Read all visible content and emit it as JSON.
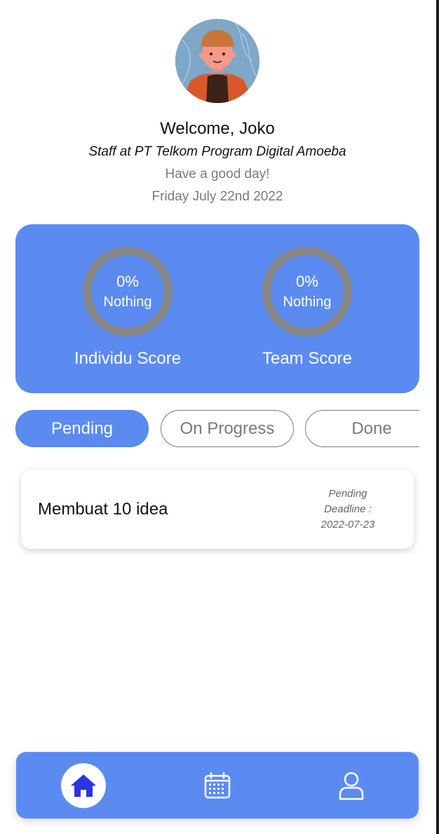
{
  "profile": {
    "welcome": "Welcome, Joko",
    "role": "Staff at PT Telkom Program Digital Amoeba",
    "greeting": "Have a good day!",
    "date": "Friday July 22nd 2022"
  },
  "scores": {
    "individu": {
      "percent": "0%",
      "status": "Nothing",
      "label": "Individu Score"
    },
    "team": {
      "percent": "0%",
      "status": "Nothing",
      "label": "Team Score"
    }
  },
  "tabs": [
    {
      "label": "Pending"
    },
    {
      "label": "On Progress"
    },
    {
      "label": "Done"
    }
  ],
  "tasks": [
    {
      "title": "Membuat 10 idea",
      "status": "Pending",
      "deadline_label": "Deadline :",
      "deadline": "2022-07-23"
    }
  ],
  "nav": {
    "home_icon": "home-icon",
    "calendar_icon": "calendar-icon",
    "profile_icon": "user-icon"
  },
  "colors": {
    "accent": "#5b8bf1",
    "ring": "#888888",
    "home_icon": "#2b33e6"
  }
}
